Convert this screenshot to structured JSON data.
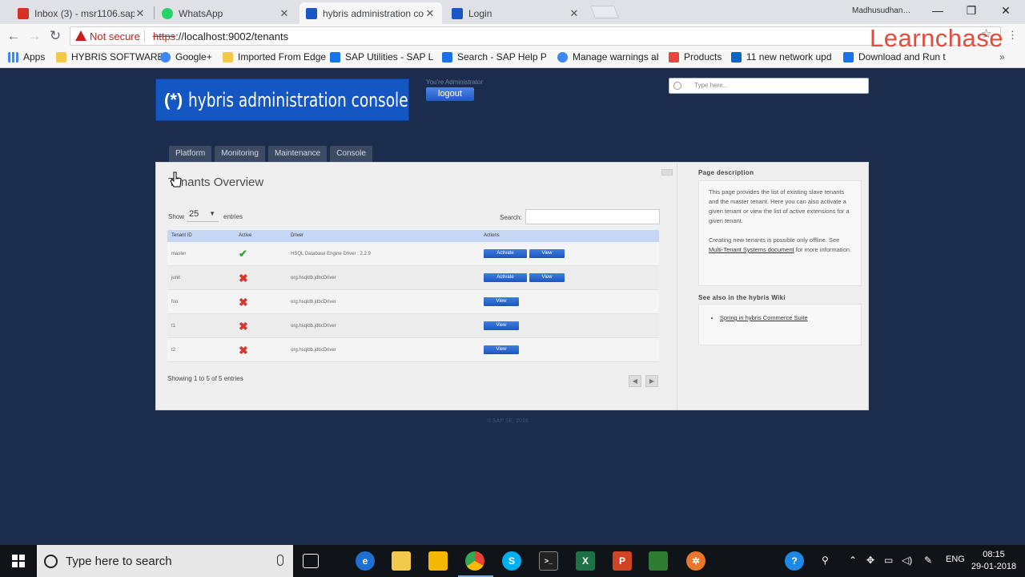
{
  "browser": {
    "tabs": [
      {
        "title": "Inbox (3) - msr1106.sap@",
        "icon_color": "#d93025"
      },
      {
        "title": "WhatsApp",
        "icon_color": "#25d366"
      },
      {
        "title": "hybris administration co",
        "icon_color": "#1a56c8"
      },
      {
        "title": "Login",
        "icon_color": "#1a56c8"
      }
    ],
    "user_name": "Madhusudhan…",
    "security_label": "Not secure",
    "url_scheme": "https",
    "url_rest": "://localhost:9002/tenants",
    "watermark": "Learnchase",
    "bookmarks": [
      {
        "label": "Apps",
        "icon_color": "#4285f4"
      },
      {
        "label": "HYBRIS SOFTWARE",
        "icon_color": "#f2c94c"
      },
      {
        "label": "Google+",
        "icon_color": "#4285f4"
      },
      {
        "label": "Imported From Edge",
        "icon_color": "#f2c94c"
      },
      {
        "label": "SAP Utilities - SAP Li",
        "icon_color": "#1a73e8"
      },
      {
        "label": "Search - SAP Help Po",
        "icon_color": "#1a73e8"
      },
      {
        "label": "Manage warnings ab",
        "icon_color": "#4285f4"
      },
      {
        "label": "Products",
        "icon_color": "#e8453c"
      },
      {
        "label": "11 new network upd",
        "icon_color": "#0a66c2"
      },
      {
        "label": "Download and Run t",
        "icon_color": "#1a73e8"
      }
    ]
  },
  "header": {
    "logo_mark": "(*)",
    "logo_text": "hybris administration console",
    "admin_label": "You're Administrator",
    "logout_label": "logout",
    "search_placeholder": "Type here..."
  },
  "nav": {
    "tabs": [
      "Platform",
      "Monitoring",
      "Maintenance",
      "Console"
    ]
  },
  "main": {
    "title": "Tenants Overview",
    "show_label": "Show",
    "entries_value": "25",
    "entries_label": "entries",
    "search_label": "Search:",
    "columns": [
      "Tenant ID",
      "Active",
      "Driver",
      "Actions"
    ],
    "rows": [
      {
        "id": "master",
        "active": true,
        "driver": "HSQL Database Engine Driver : 2.2.9",
        "actions": [
          "Activate",
          "View"
        ]
      },
      {
        "id": "junit",
        "active": false,
        "driver": "org.hsqldb.jdbcDriver",
        "actions": [
          "Activate",
          "View"
        ]
      },
      {
        "id": "foo",
        "active": false,
        "driver": "org.hsqldb.jdbcDriver",
        "actions": [
          "View"
        ]
      },
      {
        "id": "t1",
        "active": false,
        "driver": "org.hsqldb.jdbcDriver",
        "actions": [
          "View"
        ]
      },
      {
        "id": "t2",
        "active": false,
        "driver": "org.hsqldb.jdbcDriver",
        "actions": [
          "View"
        ]
      }
    ],
    "showing_text": "Showing 1 to 5 of 5 entries"
  },
  "sidebar": {
    "description_heading": "Page description",
    "description_p1": "This page provides the list of existing slave tenants and the master tenant. Here you can also activate a given tenant or view the list of active extensions for a given tenant.",
    "description_p2_pre": "Creating new tenants is possible only offline. See ",
    "description_link": "Multi-Tenant Systems document",
    "description_p2_post": " for more information.",
    "wiki_heading": "See also in the hybris Wiki",
    "wiki_links": [
      "Spring in hybris Commerce Suite"
    ]
  },
  "footer": {
    "text": "© SAP SE, 2016"
  },
  "taskbar": {
    "search_placeholder": "Type here to search",
    "language": "ENG",
    "time": "08:15",
    "date": "29-01-2018"
  }
}
